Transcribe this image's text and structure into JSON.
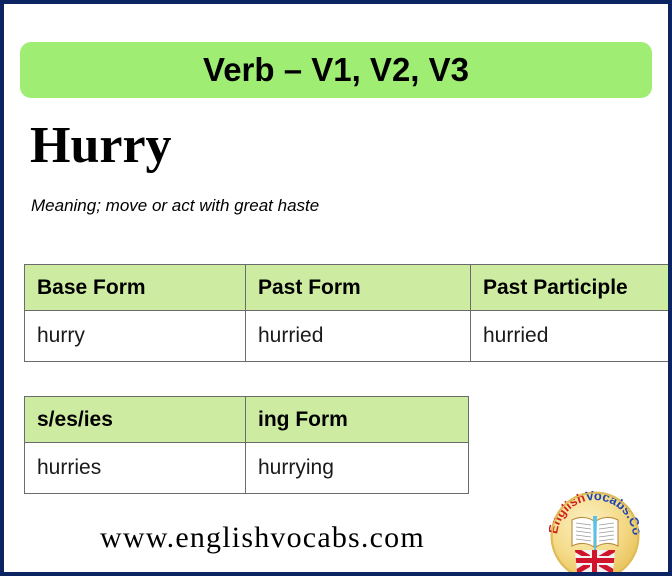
{
  "banner": {
    "title": "Verb – V1, V2, V3"
  },
  "word": {
    "headword": "Hurry",
    "meaning": "Meaning; move or act with great haste"
  },
  "forms_table": {
    "headers": [
      "Base Form",
      "Past Form",
      "Past Participle"
    ],
    "row": [
      "hurry",
      "hurried",
      "hurried"
    ]
  },
  "inflection_table": {
    "headers": [
      "s/es/ies",
      "ing Form"
    ],
    "row": [
      "hurries",
      "hurrying"
    ]
  },
  "footer": {
    "site_url": "www.englishvocabs.com"
  },
  "logo": {
    "text_red": "English",
    "text_blue": "Vocabs.Com",
    "circle_color": "#f3d87a",
    "red": "#d11f1f",
    "blue": "#1f45b0"
  },
  "colors": {
    "page_border": "#0c2461",
    "banner_green": "#a0ed73",
    "table_header_green": "#cdeba1",
    "table_border": "#6b6b6b",
    "text": "#000000"
  }
}
